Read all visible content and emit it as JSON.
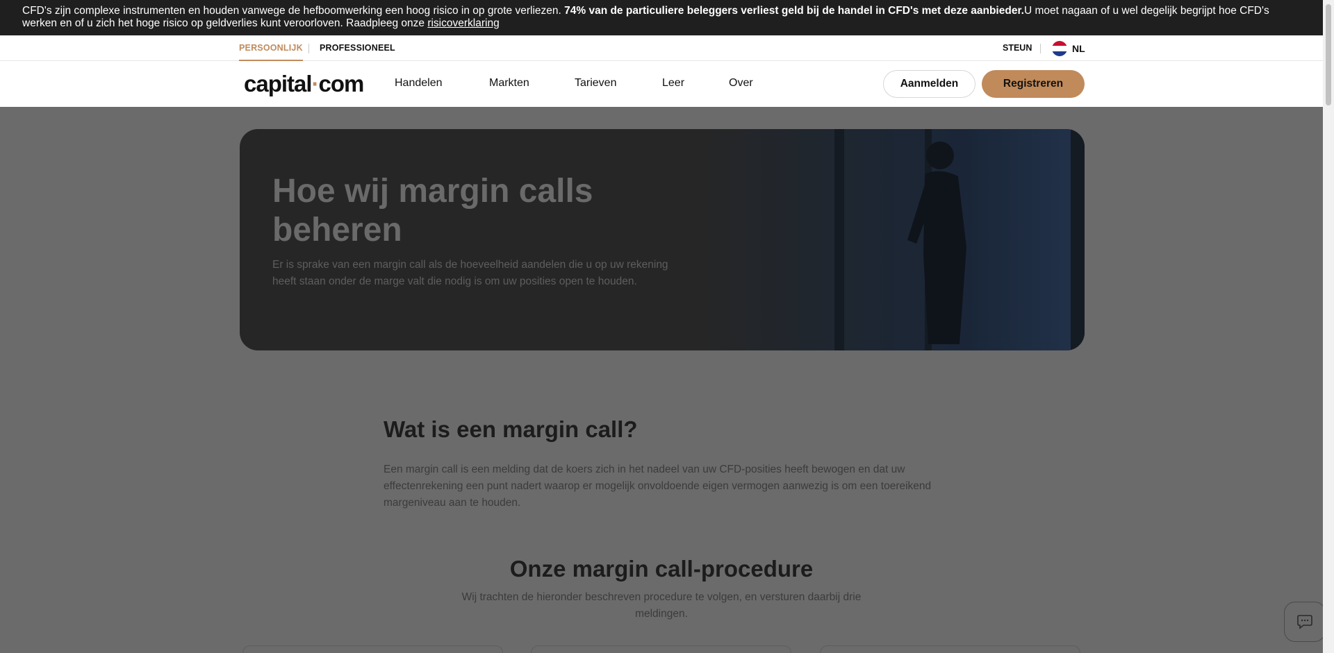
{
  "risk_warning": {
    "text_before": "CFD's zijn complexe instrumenten en houden vanwege de hefboomwerking een hoog risico in op grote verliezen. ",
    "bold_text": "74% van de particuliere beleggers verliest geld bij de handel in CFD's met deze aanbieder.",
    "text_after": "U moet nagaan of u wel degelijk begrijpt hoe CFD's werken en of u zich het hoge risico op geldverlies kunt veroorloven. Raadpleeg onze ",
    "link_label": "risicoverklaring"
  },
  "top_nav": {
    "segments": [
      "PERSOONLIJK",
      "PROFESSIONEEL"
    ],
    "active_segment": "PERSOONLIJK",
    "support_label": "STEUN",
    "language_code": "NL",
    "flag_icon": "netherlands-flag-icon"
  },
  "main_nav": {
    "logo_left": "capital",
    "logo_dot": "·",
    "logo_right": "com",
    "items": [
      "Handelen",
      "Markten",
      "Tarieven",
      "Leer",
      "Over"
    ],
    "login_label": "Aanmelden",
    "register_label": "Registreren"
  },
  "hero": {
    "title": "Hoe wij margin calls beheren",
    "subtitle": "Er is sprake van een margin call als de hoeveelheid aandelen die u op uw rekening heeft staan onder de marge valt die nodig is om uw posities open te houden."
  },
  "section_what": {
    "title": "Wat is een margin call?",
    "body": "Een margin call is een melding dat de koers zich in het nadeel van uw CFD-posities heeft bewogen en dat uw effectenrekening een punt nadert waarop er mogelijk onvoldoende eigen vermogen aanwezig is om een toereikend margeniveau aan te houden."
  },
  "section_procedure": {
    "title": "Onze margin call-procedure",
    "subtitle": "Wij trachten de hieronder beschreven procedure te volgen, en versturen daarbij drie meldingen."
  },
  "chat": {
    "icon": "chat-icon"
  },
  "colors": {
    "accent": "#c08a5b",
    "risk_bar_bg": "#1f1f1f",
    "overlay": "#6b6b6b",
    "hero_bg": "#262626"
  }
}
